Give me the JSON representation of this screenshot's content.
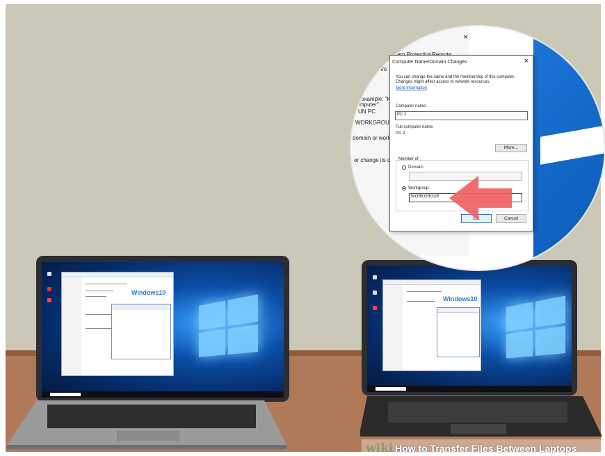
{
  "scene": {
    "left_laptop": {
      "brand_text": "Windows10"
    },
    "right_laptop": {
      "brand_text": "Windows10"
    }
  },
  "zoom": {
    "background_window": {
      "close": "×",
      "tab_1": "stem Protection",
      "tab_2": "Remote",
      "frag_1": "nfo",
      "frag_2": "example: \"Ki",
      "frag_3": "mputer\".",
      "frag_4": "UN PC",
      "frag_5": "WORKGROUP",
      "frag_6": "domain or workg",
      "frag_7": "or change its do"
    },
    "dialog": {
      "title": "Computer Name/Domain Changes",
      "close": "×",
      "description": "You can change the name and the membership of this computer. Changes might affect access to network resources.",
      "more_info_link": "More information",
      "computer_name_label": "Computer name:",
      "computer_name_value": "PC 2",
      "full_name_label": "Full computer name:",
      "full_name_value": "PC 2",
      "more_button": "More...",
      "member_of_label": "Member of",
      "domain_label": "Domain:",
      "domain_value": "",
      "workgroup_label": "Workgroup:",
      "workgroup_value": "WORKGROUP",
      "ok_button": "OK",
      "cancel_button": "Cancel",
      "selected_option": "Workgroup"
    }
  },
  "watermark": {
    "wiki": "wiki",
    "title": "How to Transfer Files Between Laptops"
  },
  "colors": {
    "wall": "#cbc8b8",
    "table": "#b07a58",
    "arrow": "#f05f63",
    "dialog_border": "#2f73c6"
  }
}
